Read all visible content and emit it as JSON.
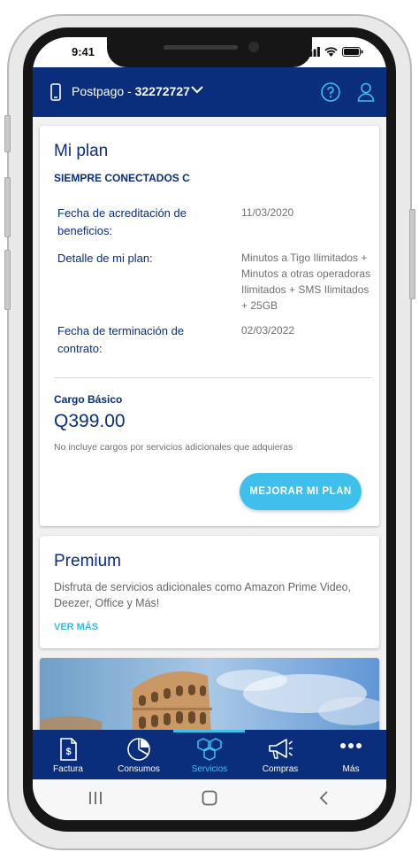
{
  "status_bar": {
    "time": "9:41"
  },
  "header": {
    "plan_type": "Postpago - ",
    "number": "32272727",
    "icons": {
      "phone": "smartphone-icon",
      "chevron": "chevron-down-icon",
      "help": "help-circle-icon",
      "user": "user-icon"
    }
  },
  "my_plan": {
    "title": "Mi plan",
    "plan_name": "SIEMPRE CONECTADOS C",
    "rows": [
      {
        "label": "Fecha de acreditación de beneficios:",
        "value": "11/03/2020"
      },
      {
        "label": "Detalle de mi plan:",
        "value": "Minutos a Tigo Ilimitados + Minutos a otras operadoras Ilimitados + SMS Ilimitados + 25GB"
      },
      {
        "label": "Fecha de terminación de contrato:",
        "value": "02/03/2022"
      }
    ],
    "cargo_label": "Cargo Básico",
    "cargo_price": "Q399.00",
    "cargo_note": "No incluye cargos por servicios adicionales que adquieras",
    "upgrade_button": "MEJORAR MI PLAN"
  },
  "premium": {
    "title": "Premium",
    "description": "Disfruta de servicios adicionales como Amazon Prime Video, Deezer, Office y Más!",
    "link": "VER MÁS"
  },
  "tabs": [
    {
      "label": "Factura",
      "icon": "invoice-icon",
      "active": false
    },
    {
      "label": "Consumos",
      "icon": "pie-chart-icon",
      "active": false
    },
    {
      "label": "Servicios",
      "icon": "hexagons-icon",
      "active": true
    },
    {
      "label": "Compras",
      "icon": "megaphone-icon",
      "active": false
    },
    {
      "label": "Más",
      "icon": "more-dots-icon",
      "active": false
    }
  ],
  "colors": {
    "brand": "#0a2d7c",
    "accent": "#3fc0ec"
  }
}
